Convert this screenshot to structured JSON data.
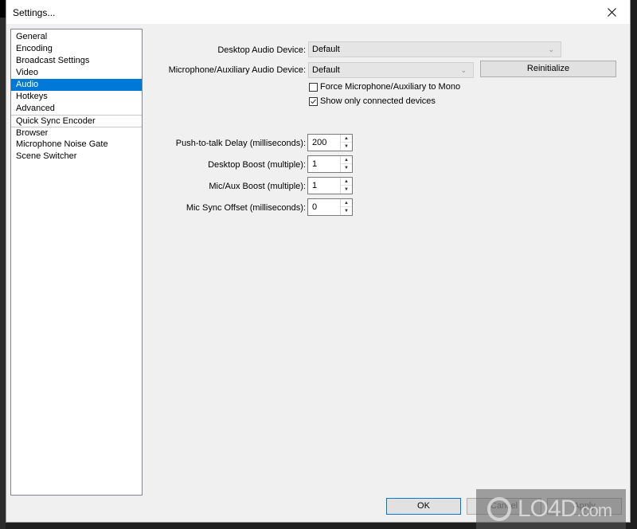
{
  "window": {
    "title": "Settings...",
    "close_icon": "close-icon"
  },
  "sidebar": {
    "items": [
      {
        "label": "General",
        "selected": false
      },
      {
        "label": "Encoding",
        "selected": false
      },
      {
        "label": "Broadcast Settings",
        "selected": false
      },
      {
        "label": "Video",
        "selected": false
      },
      {
        "label": "Audio",
        "selected": true
      },
      {
        "label": "Hotkeys",
        "selected": false
      },
      {
        "label": "Advanced",
        "selected": false
      },
      {
        "label": "Quick Sync Encoder",
        "selected": false
      },
      {
        "label": "Browser",
        "selected": false
      },
      {
        "label": "Microphone Noise Gate",
        "selected": false
      },
      {
        "label": "Scene Switcher",
        "selected": false
      }
    ]
  },
  "audio": {
    "desktop_device_label": "Desktop Audio Device:",
    "desktop_device_value": "Default",
    "mic_device_label": "Microphone/Auxiliary Audio Device:",
    "mic_device_value": "Default",
    "reinitialize_label": "Reinitialize",
    "force_mono_label": "Force Microphone/Auxiliary to Mono",
    "force_mono_checked": false,
    "show_connected_label": "Show only connected devices",
    "show_connected_checked": true,
    "spinners": [
      {
        "label": "Push-to-talk Delay (milliseconds):",
        "value": "200"
      },
      {
        "label": "Desktop Boost (multiple):",
        "value": "1"
      },
      {
        "label": "Mic/Aux Boost (multiple):",
        "value": "1"
      },
      {
        "label": "Mic Sync Offset (milliseconds):",
        "value": "0"
      }
    ]
  },
  "footer": {
    "ok_label": "OK",
    "cancel_label": "Cancel",
    "apply_label": "Apply"
  },
  "watermark": {
    "text": "LO4D",
    "suffix": ".com"
  }
}
